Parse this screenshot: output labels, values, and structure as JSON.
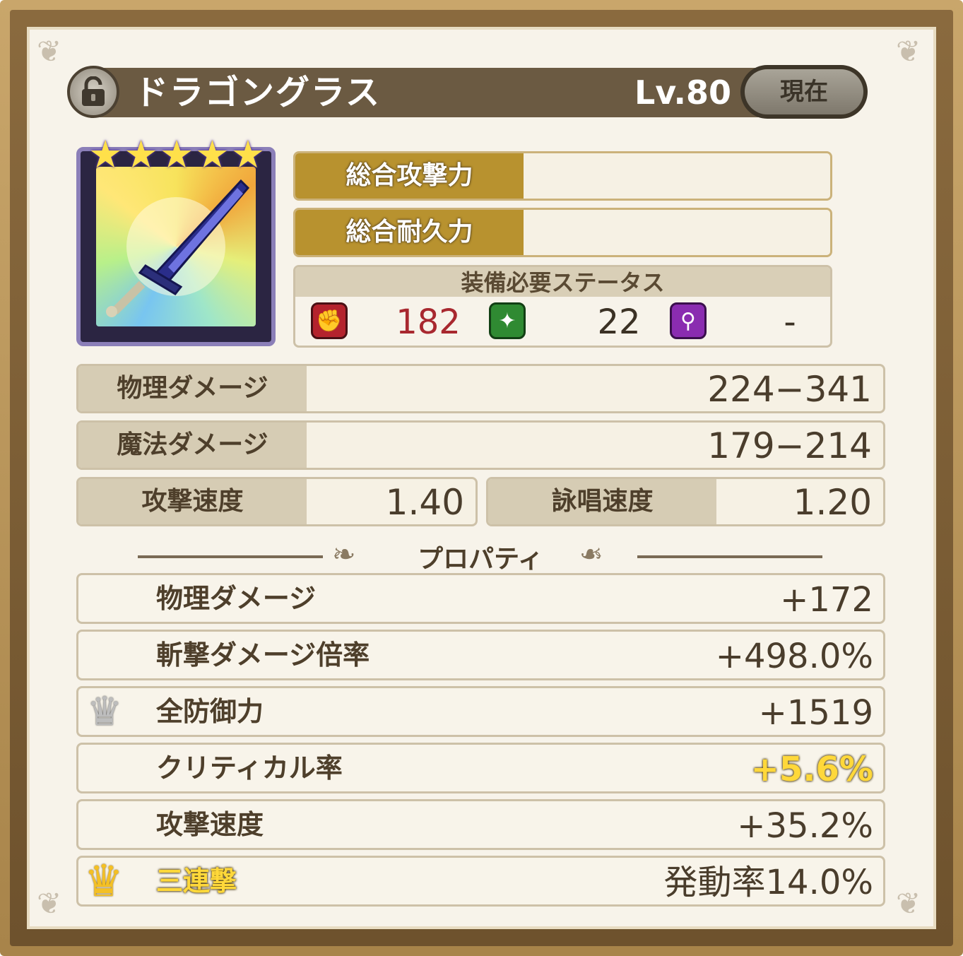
{
  "item": {
    "name": "ドラゴングラス",
    "level": "Lv.80",
    "current_button": "現在",
    "rarity_stars": 5
  },
  "summary": {
    "attack_label": "総合攻撃力",
    "durability_label": "総合耐久力"
  },
  "requirements": {
    "title": "装備必要ステータス",
    "strength": "182",
    "dexterity": "22",
    "intelligence": "-"
  },
  "stats": {
    "physical_damage_label": "物理ダメージ",
    "physical_damage_value": "224−341",
    "magic_damage_label": "魔法ダメージ",
    "magic_damage_value": "179−214",
    "attack_speed_label": "攻撃速度",
    "attack_speed_value": "1.40",
    "cast_speed_label": "詠唱速度",
    "cast_speed_value": "1.20"
  },
  "properties_title": "プロパティ",
  "properties": [
    {
      "label": "物理ダメージ",
      "value": "+172"
    },
    {
      "label": "斬撃ダメージ倍率",
      "value": "+498.0%"
    },
    {
      "label": "全防御力",
      "value": "+1519"
    },
    {
      "label": "クリティカル率",
      "value": "+5.6%"
    },
    {
      "label": "攻撃速度",
      "value": "+35.2%"
    },
    {
      "label": "三連撃",
      "value": "発動率14.0%"
    }
  ],
  "colors": {
    "requirement_strength": "#a8282f",
    "highlight_gold": "#ffd83a"
  }
}
